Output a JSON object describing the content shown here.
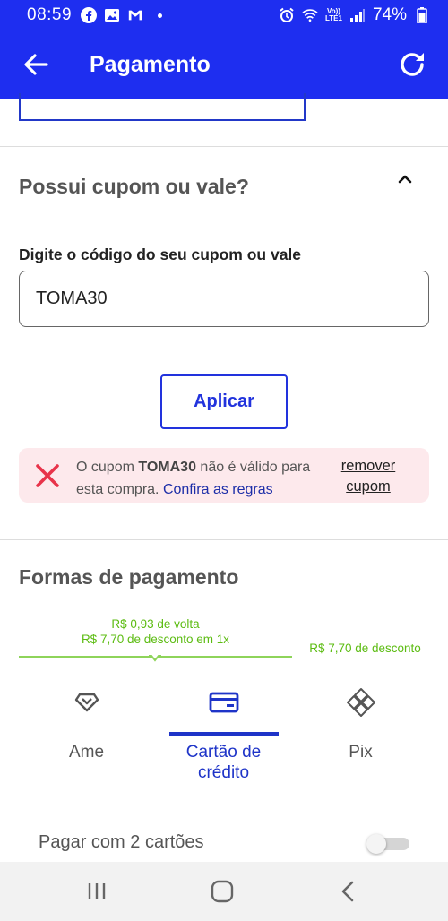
{
  "status_bar": {
    "time": "08:59",
    "battery": "74%",
    "volte_top": "Vo))",
    "volte_bottom": "LTE1"
  },
  "app_bar": {
    "title": "Pagamento",
    "back_icon": "arrow-left-icon",
    "refresh_icon": "refresh-icon"
  },
  "coupon": {
    "title": "Possui cupom ou vale?",
    "input_label": "Digite o código do seu cupom ou vale",
    "input_value": "TOMA30",
    "apply_label": "Aplicar",
    "error": {
      "prefix": "O cupom ",
      "code": "TOMA30",
      "middle": " não é válido para esta compra. ",
      "link": "Confira as regras",
      "remove_label": "remover cupom"
    }
  },
  "payments": {
    "title": "Formas de pagamento",
    "promo_left_line1": "R$ 0,93 de volta",
    "promo_left_line2": "R$ 7,70 de desconto em 1x",
    "promo_right": "R$ 7,70 de desconto",
    "methods": [
      {
        "label": "Ame",
        "icon": "ame-heart-icon",
        "active": false
      },
      {
        "label": "Cartão de crédito",
        "icon": "credit-card-icon",
        "active": true
      },
      {
        "label": "Pix",
        "icon": "pix-icon",
        "active": false
      }
    ],
    "two_cards_label": "Pagar com 2 cartões",
    "two_cards_enabled": false
  },
  "colors": {
    "brand_blue": "#1e2ef0",
    "accent_blue": "#1e34c8",
    "promo_green": "#5cbc12",
    "error_bg": "#fde9ec",
    "error_red": "#e8334a"
  }
}
